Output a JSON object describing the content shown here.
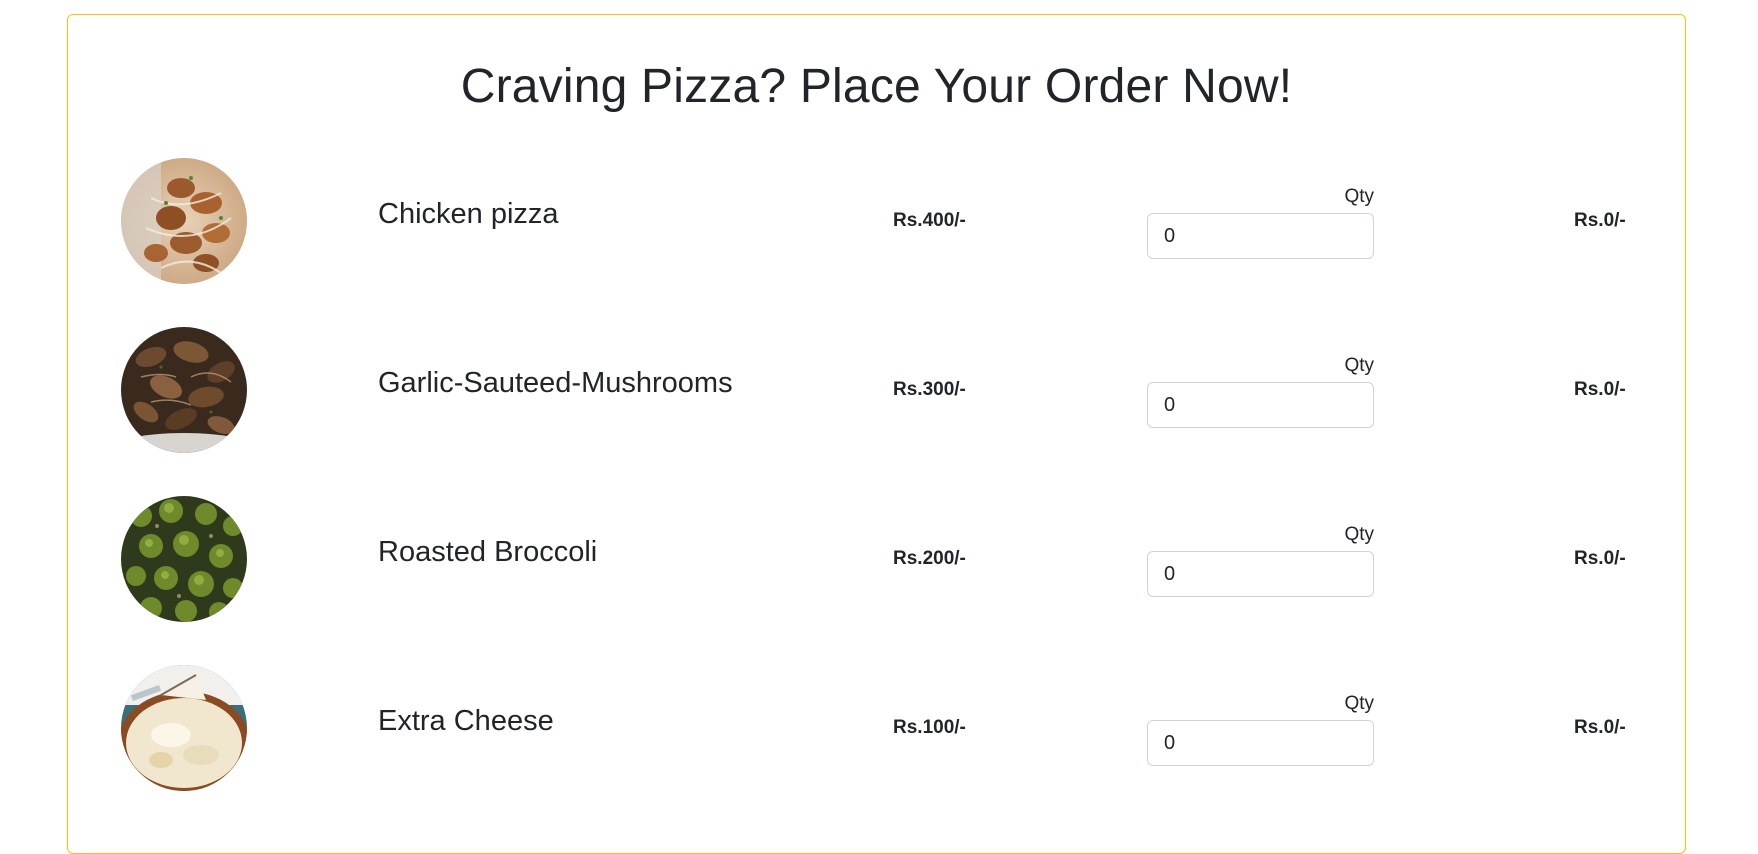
{
  "header": {
    "title": "Craving Pizza? Place Your Order Now!"
  },
  "colors": {
    "card_border": "#ffc107",
    "input_border": "#ced4da",
    "text": "#212529"
  },
  "items": [
    {
      "name": "Chicken pizza",
      "price": "Rs.400/-",
      "qty_label": "Qty",
      "qty_value": "0",
      "total": "Rs.0/-",
      "image_icon": "chicken-pizza-image"
    },
    {
      "name": "Garlic-Sauteed-Mushrooms",
      "price": "Rs.300/-",
      "qty_label": "Qty",
      "qty_value": "0",
      "total": "Rs.0/-",
      "image_icon": "mushrooms-image"
    },
    {
      "name": "Roasted Broccoli",
      "price": "Rs.200/-",
      "qty_label": "Qty",
      "qty_value": "0",
      "total": "Rs.0/-",
      "image_icon": "broccoli-image"
    },
    {
      "name": "Extra Cheese",
      "price": "Rs.100/-",
      "qty_label": "Qty",
      "qty_value": "0",
      "total": "Rs.0/-",
      "image_icon": "cheese-image"
    }
  ]
}
